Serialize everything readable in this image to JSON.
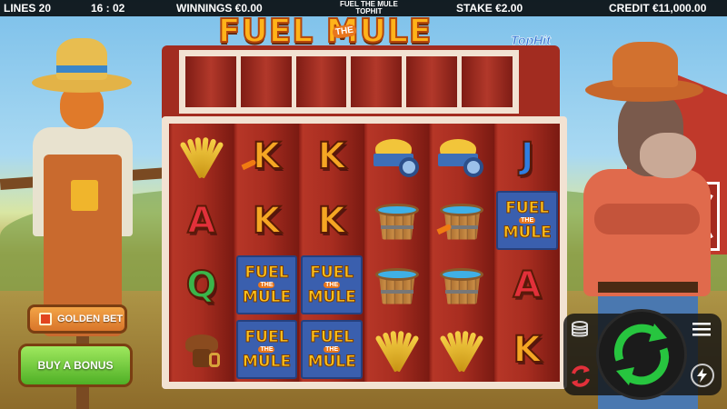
{
  "topbar": {
    "lines": "LINES 20",
    "clock": "16 : 02",
    "winnings": "WINNINGS €0.00",
    "title_line1": "FUEL THE MULE",
    "title_line2": "TOPHIT",
    "stake": "STAKE €2.00",
    "credit": "CREDIT €11,000.00"
  },
  "logo": {
    "main": "FUEL    MULE",
    "the": "THE",
    "brand": "TopHit"
  },
  "reels": [
    [
      "wheat",
      "K",
      "K",
      "cart",
      "cart",
      "J"
    ],
    [
      "A",
      "K",
      "K",
      "bucket",
      "bucket",
      "fuel"
    ],
    [
      "Q",
      "fuel",
      "fuel",
      "bucket",
      "bucket",
      "A"
    ],
    [
      "saddle",
      "fuel",
      "fuel",
      "wheat",
      "wheat",
      "K"
    ]
  ],
  "fuel_symbol": {
    "top": "FUEL",
    "the": "THE",
    "bottom": "MULE"
  },
  "buttons": {
    "golden_bet": "GOLDEN BET",
    "buy_bonus": "BUY A BONUS"
  },
  "icons": {
    "coins": "coin-stack-icon",
    "spin": "spin-icon",
    "menu": "menu-icon",
    "autoplay": "autoplay-icon",
    "turbo": "lightning-icon"
  },
  "colors": {
    "spin_arrow": "#27c53f",
    "bonus_button": "#4fb026",
    "golden_bet": "#d9752a"
  }
}
